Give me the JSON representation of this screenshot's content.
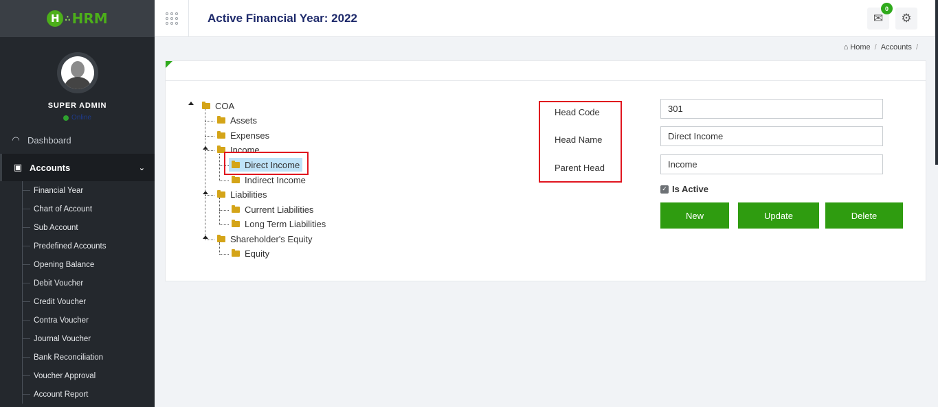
{
  "brand": {
    "logo_letter": "H",
    "logo_text": "HRM"
  },
  "profile": {
    "name": "SUPER ADMIN",
    "status": "Online"
  },
  "nav": {
    "dashboard": "Dashboard",
    "accounts": "Accounts",
    "submenu": [
      "Financial Year",
      "Chart of Account",
      "Sub Account",
      "Predefined Accounts",
      "Opening Balance",
      "Debit Voucher",
      "Credit Voucher",
      "Contra Voucher",
      "Journal Voucher",
      "Bank Reconciliation",
      "Voucher Approval",
      "Account Report"
    ]
  },
  "header": {
    "title": "Active Financial Year: 2022",
    "mail_count": "0"
  },
  "breadcrumb": {
    "home": "Home",
    "current": "Accounts"
  },
  "tree": {
    "root": "COA",
    "assets": "Assets",
    "expenses": "Expenses",
    "income": "Income",
    "direct_income": "Direct Income",
    "indirect_income": "Indirect Income",
    "liabilities": "Liabilities",
    "current_liabilities": "Current Liabilities",
    "long_term_liabilities": "Long Term Liabilities",
    "equity_parent": "Shareholder's Equity",
    "equity": "Equity"
  },
  "form": {
    "head_code_label": "Head Code",
    "head_name_label": "Head Name",
    "parent_head_label": "Parent Head",
    "head_code": "301",
    "head_name": "Direct Income",
    "parent_head": "Income",
    "is_active_label": "Is Active",
    "is_active": true,
    "new_label": "New",
    "update_label": "Update",
    "delete_label": "Delete"
  },
  "colors": {
    "accent": "#2f9c10",
    "sidebar": "#24282d",
    "title": "#1e2a6b",
    "highlight": "#e0141e"
  }
}
